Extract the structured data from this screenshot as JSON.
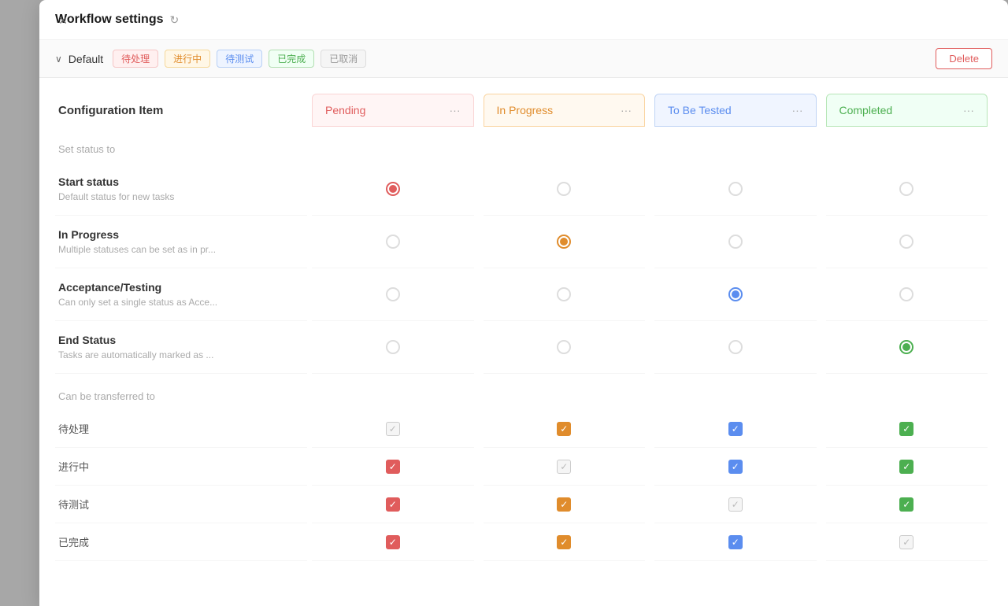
{
  "modal": {
    "title": "Workflow settings",
    "close_label": "×",
    "refresh_icon": "↻"
  },
  "toolbar": {
    "workflow_name": "Default",
    "chevron": "∨",
    "tags": [
      {
        "label": "待处理",
        "class": "tag-pending"
      },
      {
        "label": "进行中",
        "class": "tag-inprogress"
      },
      {
        "label": "待测试",
        "class": "tag-tobetested"
      },
      {
        "label": "已完成",
        "class": "tag-completed"
      },
      {
        "label": "已取消",
        "class": "tag-cancelled"
      }
    ],
    "delete_label": "Delete"
  },
  "grid": {
    "config_item_label": "Configuration Item",
    "columns": [
      {
        "label": "Pending",
        "class": "header-pending"
      },
      {
        "label": "In Progress",
        "class": "header-inprogress"
      },
      {
        "label": "To Be Tested",
        "class": "header-tobetested"
      },
      {
        "label": "Completed",
        "class": "header-completed"
      }
    ],
    "set_status_label": "Set status to",
    "rows_set_status": [
      {
        "name": "Start status",
        "desc": "Default status for new tasks",
        "radios": [
          "selected-red",
          "none",
          "none",
          "none"
        ]
      },
      {
        "name": "In Progress",
        "desc": "Multiple statuses can be set as in pr...",
        "radios": [
          "none",
          "selected-orange",
          "none",
          "none"
        ]
      },
      {
        "name": "Acceptance/Testing",
        "desc": "Can only set a single status as Acce...",
        "radios": [
          "none",
          "none",
          "selected-blue",
          "none"
        ]
      },
      {
        "name": "End Status",
        "desc": "Tasks are automatically marked as ...",
        "radios": [
          "none",
          "none",
          "none",
          "selected-green"
        ]
      }
    ],
    "can_transfer_label": "Can be transferred to",
    "rows_transfer": [
      {
        "label": "待处理",
        "checkboxes": [
          "disabled-checked",
          "checked-orange",
          "checked-blue",
          "checked-green"
        ]
      },
      {
        "label": "进行中",
        "checkboxes": [
          "checked-red",
          "disabled-checked",
          "checked-blue",
          "checked-green"
        ]
      },
      {
        "label": "待测试",
        "checkboxes": [
          "checked-red",
          "checked-orange",
          "disabled-checked",
          "checked-green"
        ]
      },
      {
        "label": "已完成",
        "checkboxes": [
          "checked-red",
          "checked-orange",
          "checked-blue",
          "disabled-checked"
        ]
      }
    ]
  }
}
